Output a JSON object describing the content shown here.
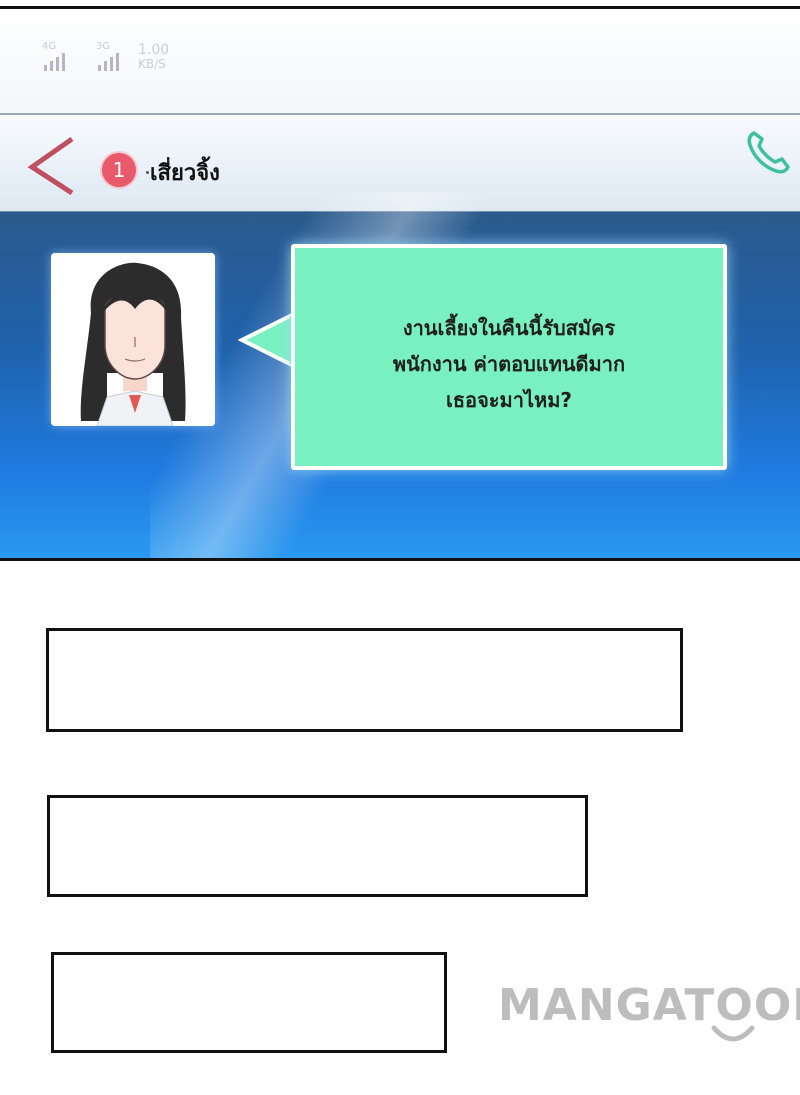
{
  "status_bar": {
    "signal_1_label": "4G",
    "signal_2_label": "3G",
    "speed_value": "1.00",
    "speed_unit": "KB/S"
  },
  "header": {
    "back_icon": "chevron-left-icon",
    "unread_count": "1",
    "contact_name": "เสี่ยวจิ้ง",
    "call_icon": "phone-icon"
  },
  "message": {
    "line_1": "งานเลี้ยงในคืนนี้รับสมัคร",
    "line_2": "พนักงาน ค่าตอบแทนดีมาก",
    "line_3": "เธอจะมาไหม?"
  },
  "colors": {
    "bubble": "#79f0bf",
    "badge": "#e8596b",
    "back_arrow": "#c0505f",
    "call_icon": "#3fbfa0"
  },
  "watermark": {
    "logo_text": "MANGATOON"
  }
}
